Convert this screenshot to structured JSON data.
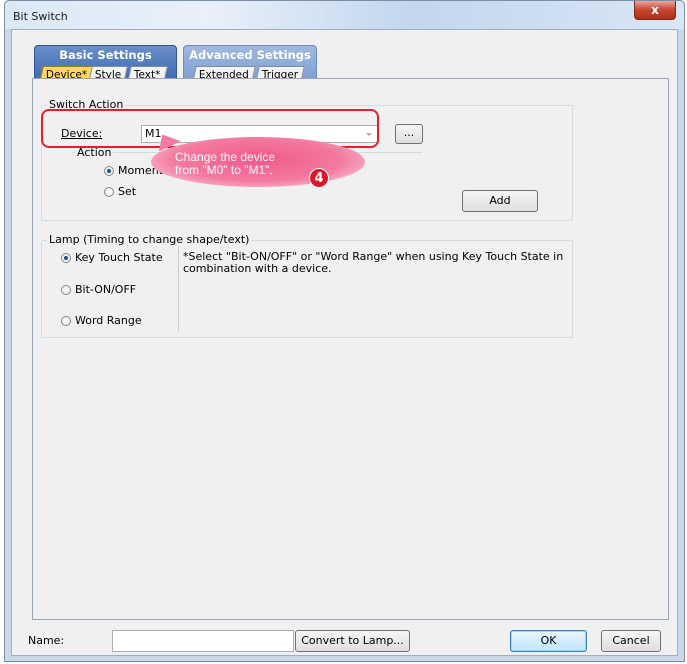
{
  "window": {
    "title": "Bit Switch",
    "close_glyph": "x"
  },
  "tab_groups": [
    {
      "title": "Basic Settings",
      "tabs": [
        "Device*",
        "Style",
        "Text*"
      ]
    },
    {
      "title": "Advanced Settings",
      "tabs": [
        "Extended",
        "Trigger"
      ]
    }
  ],
  "switch_action": {
    "legend": "Switch Action",
    "device_label": "Device:",
    "device_value": "M1",
    "browse_label": "...",
    "action_legend": "Action",
    "action_options": [
      "Momentary",
      "Set"
    ],
    "add_label": "Add"
  },
  "callout": {
    "line1": "Change the device",
    "line2": "from \"M0\" to \"M1\".",
    "step": "4"
  },
  "lamp": {
    "legend": "Lamp (Timing to change shape/text)",
    "options": [
      "Key Touch State",
      "Bit-ON/OFF",
      "Word Range"
    ],
    "note": "*Select \"Bit-ON/OFF\" or \"Word Range\" when using Key Touch State in combination with a device."
  },
  "footer": {
    "name_label": "Name:",
    "name_value": "",
    "convert_label": "Convert to Lamp...",
    "ok_label": "OK",
    "cancel_label": "Cancel"
  },
  "colors": {
    "highlight_frame": "#e2202c",
    "active_tab": "#ffd85a",
    "basic_group": "#3c68b0",
    "advanced_group": "#7e9ed0",
    "callout": "#f37aa0"
  }
}
